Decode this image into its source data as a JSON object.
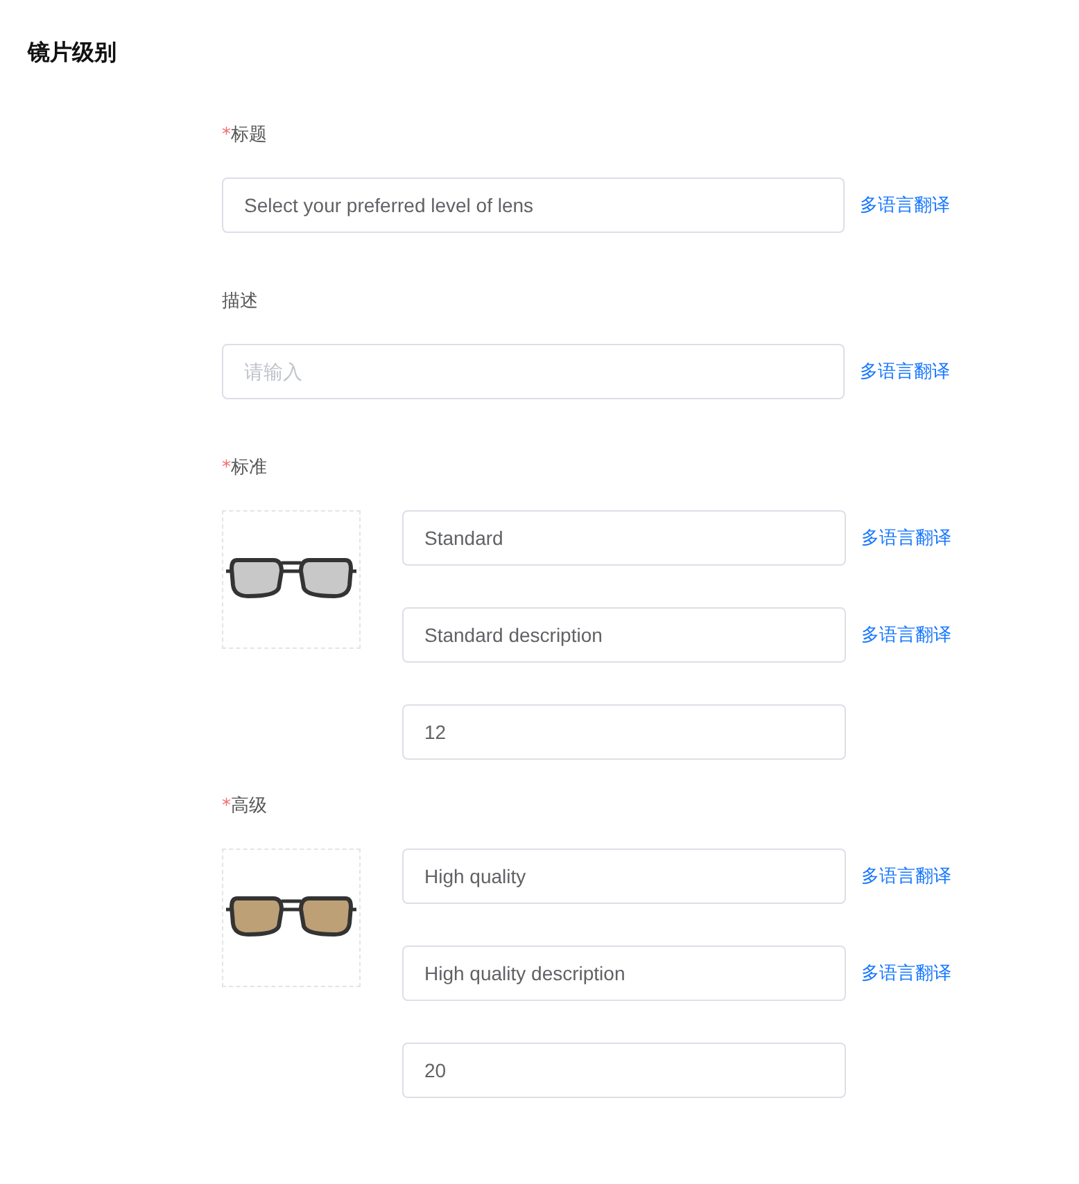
{
  "section_title": "镜片级别",
  "required_mark": "*",
  "fields": [
    {
      "label": "标题",
      "required": true,
      "value": "Select your preferred level of lens",
      "link": "多语言翻译"
    },
    {
      "label": "描述",
      "required": false,
      "placeholder": "请输入",
      "link": "多语言翻译"
    }
  ],
  "levels": [
    {
      "label": "标准",
      "required": true,
      "color": "#c8c8c8",
      "inputs": [
        {
          "value": "Standard",
          "link": "多语言翻译"
        },
        {
          "value": "Standard description",
          "link": "多语言翻译"
        },
        {
          "value": "12"
        }
      ]
    },
    {
      "label": "高级",
      "required": true,
      "color": "#bea077",
      "inputs": [
        {
          "value": "High quality",
          "link": "多语言翻译"
        },
        {
          "value": "High quality description",
          "link": "多语言翻译"
        },
        {
          "value": "20"
        }
      ]
    }
  ]
}
